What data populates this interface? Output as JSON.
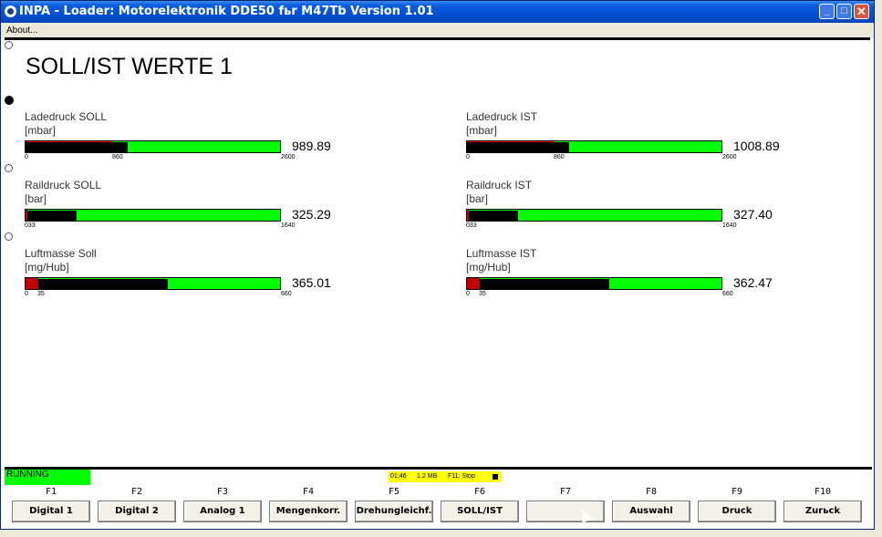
{
  "window": {
    "title": "INPA - Loader:  Motorelektronik DDE50 fьr M47Tb Version 1.01",
    "controls": {
      "minimize": "_",
      "maximize": "□",
      "close": "✕"
    }
  },
  "menu": {
    "about": "About..."
  },
  "page_title": "SOLL/IST WERTE 1",
  "gauges": [
    {
      "label": "Ladedruck SOLL",
      "unit": "[mbar]",
      "value": "989.89",
      "min": "0",
      "mid": "860",
      "max": "2600",
      "fill_fraction": 0.4,
      "red_fraction": 0.34
    },
    {
      "label": "Ladedruck IST",
      "unit": "[mbar]",
      "value": "1008.89",
      "min": "0",
      "mid": "860",
      "max": "2600",
      "fill_fraction": 0.4,
      "red_fraction": 0.34
    },
    {
      "label": "Raildruck SOLL",
      "unit": "[bar]",
      "value": "325.29",
      "min": "033",
      "mid": "",
      "max": "1640",
      "fill_fraction": 0.2,
      "red_fraction": 0.0
    },
    {
      "label": "Raildruck IST",
      "unit": "[bar]",
      "value": "327.40",
      "min": "033",
      "mid": "",
      "max": "1640",
      "fill_fraction": 0.2,
      "red_fraction": 0.0
    },
    {
      "label": "Luftmasse Soll",
      "unit": "[mg/Hub]",
      "value": "365.01",
      "min": "0",
      "mid": "35",
      "max": "660",
      "fill_fraction": 0.56,
      "red_fraction": 0.05
    },
    {
      "label": "Luftmasse IST",
      "unit": "[mg/Hub]",
      "value": "362.47",
      "min": "0",
      "mid": "35",
      "max": "660",
      "fill_fraction": 0.56,
      "red_fraction": 0.05
    }
  ],
  "status": {
    "running": "RUNNING",
    "time": "01:46",
    "memory": "1.2 MB",
    "stop_hint": "F11: Stop"
  },
  "function_keys": [
    {
      "key": "F1",
      "label": "Digital 1"
    },
    {
      "key": "F2",
      "label": "Digital 2"
    },
    {
      "key": "F3",
      "label": "Analog 1"
    },
    {
      "key": "F4",
      "label": "Mengenkorr."
    },
    {
      "key": "F5",
      "label": "Drehungleichf."
    },
    {
      "key": "F6",
      "label": "SOLL/IST"
    },
    {
      "key": "F7",
      "label": ""
    },
    {
      "key": "F8",
      "label": "Auswahl"
    },
    {
      "key": "F9",
      "label": "Druck"
    },
    {
      "key": "F10",
      "label": "Zurьck"
    }
  ]
}
